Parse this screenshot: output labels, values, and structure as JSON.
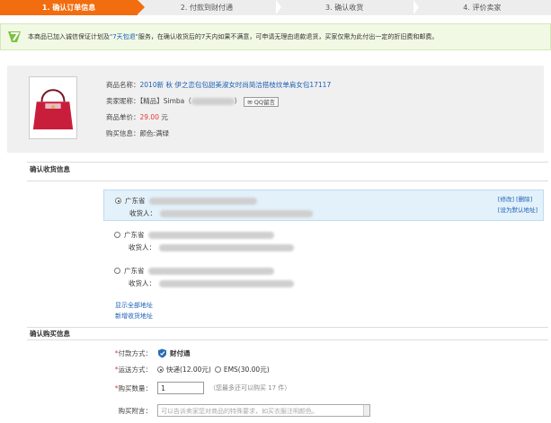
{
  "steps": [
    "1. 确认订单信息",
    "2. 付款到财付通",
    "3. 确认收货",
    "4. 评价卖家"
  ],
  "notice": {
    "before": "本商品已加入诚信保证计划及 ",
    "highlight": "\"7天包退\"",
    "after": " 服务，在确认收货后的7天内如果不满意，可申请无理由退款退货，买家仅需为此付出一定的折旧费和邮费。"
  },
  "product": {
    "name_label": "商品名称：",
    "name_value": "2010新 秋 伊之恋包包甜美淑女时尚简洁搭枝纹单肩女包17117",
    "seller_label": "卖家昵称：",
    "seller_value_prefix": "【精品】Simba（",
    "seller_value_suffix": "）",
    "qq_label": "QQ留言",
    "price_label": "商品单价：",
    "price_value": "29.00",
    "price_unit": "元",
    "buyinfo_label": "购买信息：",
    "buyinfo_value": "颜色:满绿"
  },
  "address_section": {
    "title": "确认收货信息",
    "province": "广东省",
    "receiver_label": "收货人：",
    "edit": "[修改]",
    "delete": "[删除]",
    "set_default": "[设为默认地址]",
    "show_all": "显示全部地址",
    "add_new": "新增收货地址"
  },
  "purchase_section": {
    "title": "确认购买信息",
    "pay_label": "付款方式：",
    "pay_value": "财付通",
    "ship_label": "运送方式：",
    "ship_express": "快递(12.00元)",
    "ship_ems": "EMS(30.00元)",
    "qty_label": "购买数量：",
    "qty_value": "1",
    "qty_tip": "（您最多还可以购买 17 件）",
    "note_label": "购买附言：",
    "note_placeholder": "可以告诉卖家您对商品的特殊要求，如买衣服注明颜色。"
  },
  "colors": {
    "accent": "#f26d0f",
    "link": "#1a5fb4",
    "price": "#e4393c",
    "notice_bg": "#f1f9e4",
    "selected_bg": "#e3f1fb"
  }
}
